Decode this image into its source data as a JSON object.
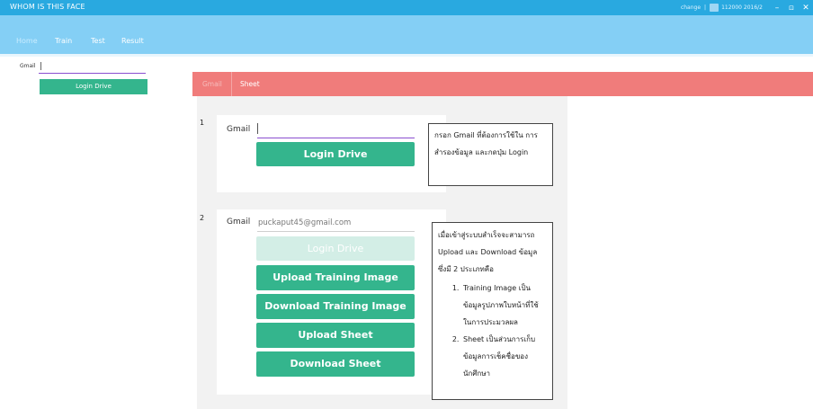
{
  "app": {
    "title": "WHOM IS THIS FACE",
    "status_change": "change",
    "status_separator": "|",
    "status_id": "112000 2016/2",
    "icons": {
      "calendar": "calendar-icon",
      "minimize": "minimize-icon",
      "maximize": "maximize-icon",
      "close": "close-icon"
    },
    "minimize_glyph": "–",
    "maximize_glyph": "⊡",
    "close_glyph": "✕"
  },
  "menu": {
    "tabs": [
      {
        "label": "Home"
      },
      {
        "label": "Train"
      },
      {
        "label": "Test"
      },
      {
        "label": "Result"
      }
    ]
  },
  "sidebar_login": {
    "gmail_label": "Gmail",
    "gmail_value": "",
    "button_label": "Login Drive"
  },
  "sheet_tabs": [
    {
      "label": "Gmail"
    },
    {
      "label": "Sheet"
    }
  ],
  "colors": {
    "titlebar": "#29a9e0",
    "menubar": "#84cff5",
    "sheetbar": "#f07c7b",
    "button": "#34b58d",
    "input_focus": "#8a4fd0"
  },
  "steps": [
    {
      "number": "1",
      "gmail_label": "Gmail",
      "gmail_value": "",
      "button_label": "Login Drive",
      "note": "กรอก Gmail ที่ต้องการใช้ใน การสำรองข้อมูล และกดปุ่ม Login"
    },
    {
      "number": "2",
      "gmail_label": "Gmail",
      "gmail_value": "puckaput45@gmail.com",
      "buttons": [
        {
          "label": "Login Drive",
          "disabled": true
        },
        {
          "label": "Upload Training Image",
          "disabled": false
        },
        {
          "label": "Download Training Image",
          "disabled": false
        },
        {
          "label": "Upload Sheet",
          "disabled": false
        },
        {
          "label": "Download Sheet",
          "disabled": false
        }
      ],
      "note_intro": "เมื่อเข้าสู่ระบบสำเร็จจะสามารถ Upload และ Download ข้อมูล ซึ่งมี 2 ประเภทคือ",
      "note_items": [
        "Training Image เป็นข้อมูลรูปภาพใบหน้าที่ใช้ในการประมวลผล",
        "Sheet เป็นส่วนการเก็บข้อมูลการเช็คชื่อของนักศึกษา"
      ]
    }
  ]
}
